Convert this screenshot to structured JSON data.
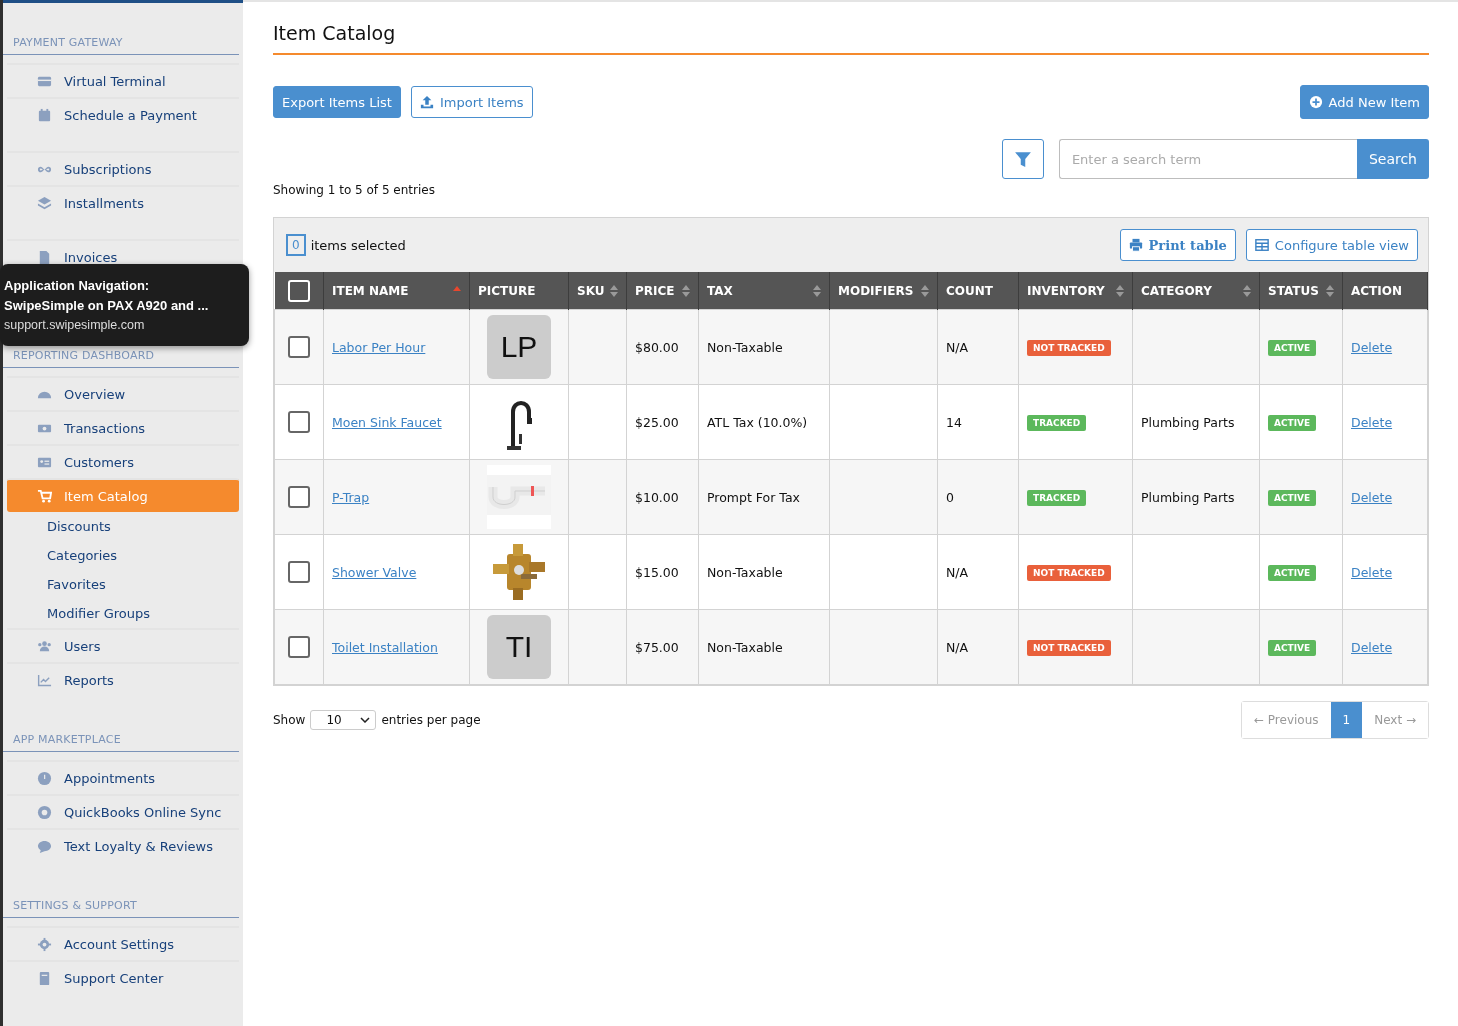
{
  "sidebar": {
    "sections": [
      {
        "title": "PAYMENT GATEWAY",
        "groups": [
          [
            {
              "label": "Virtual Terminal",
              "kind": "main",
              "selected": false
            },
            {
              "label": "Schedule a Payment",
              "kind": "main",
              "selected": false
            }
          ],
          [
            {
              "label": "Subscriptions",
              "kind": "main",
              "selected": false
            },
            {
              "label": "Installments",
              "kind": "main",
              "selected": false
            }
          ],
          [
            {
              "label": "Invoices",
              "kind": "main",
              "selected": false
            }
          ]
        ]
      },
      {
        "title": "REPORTING DASHBOARD",
        "groups": [
          [
            {
              "label": "Overview",
              "kind": "main",
              "selected": false
            },
            {
              "label": "Transactions",
              "kind": "main",
              "selected": false
            },
            {
              "label": "Customers",
              "kind": "main",
              "selected": false
            },
            {
              "label": "Item Catalog",
              "kind": "main",
              "selected": true
            },
            {
              "label": "Discounts",
              "kind": "sub",
              "selected": false
            },
            {
              "label": "Categories",
              "kind": "sub",
              "selected": false
            },
            {
              "label": "Favorites",
              "kind": "sub",
              "selected": false
            },
            {
              "label": "Modifier Groups",
              "kind": "sub",
              "selected": false
            },
            {
              "label": "Users",
              "kind": "main",
              "selected": false
            },
            {
              "label": "Reports",
              "kind": "main",
              "selected": false
            }
          ]
        ]
      },
      {
        "title": "APP MARKETPLACE",
        "groups": [
          [
            {
              "label": "Appointments",
              "kind": "main",
              "selected": false
            },
            {
              "label": "QuickBooks Online Sync",
              "kind": "main",
              "selected": false
            },
            {
              "label": "Text Loyalty & Reviews",
              "kind": "main",
              "selected": false
            }
          ]
        ]
      },
      {
        "title": "SETTINGS & SUPPORT",
        "groups": [
          [
            {
              "label": "Account Settings",
              "kind": "main",
              "selected": false
            },
            {
              "label": "Support Center",
              "kind": "main",
              "selected": false
            }
          ]
        ]
      }
    ]
  },
  "tooltip": {
    "title": "Application Navigation:",
    "subtitle": "SwipeSimple on PAX A920 and ...",
    "url": "support.swipesimple.com"
  },
  "page": {
    "title": "Item Catalog",
    "export_button": "Export Items List",
    "import_button": "Import Items",
    "add_button": "Add New Item",
    "search": {
      "placeholder": "Enter a search term",
      "button": "Search"
    },
    "showing": "Showing 1 to 5 of 5 entries"
  },
  "table": {
    "select_all_checked": false,
    "selected_count": "0",
    "selected_label": "items selected",
    "print_button": "Print table",
    "configure_button": "Configure table view",
    "columns": [
      {
        "label": "ITEM NAME",
        "sortable": true,
        "sorted": true
      },
      {
        "label": "PICTURE",
        "sortable": false,
        "sorted": false
      },
      {
        "label": "SKU",
        "sortable": true,
        "sorted": false
      },
      {
        "label": "PRICE",
        "sortable": true,
        "sorted": false
      },
      {
        "label": "TAX",
        "sortable": true,
        "sorted": false
      },
      {
        "label": "MODIFIERS",
        "sortable": true,
        "sorted": false
      },
      {
        "label": "COUNT",
        "sortable": false,
        "sorted": false
      },
      {
        "label": "INVENTORY",
        "sortable": true,
        "sorted": false
      },
      {
        "label": "CATEGORY",
        "sortable": true,
        "sorted": false
      },
      {
        "label": "STATUS",
        "sortable": true,
        "sorted": false
      },
      {
        "label": "ACTION",
        "sortable": false,
        "sorted": false
      }
    ],
    "rows": [
      {
        "checked": false,
        "name": "Labor Per Hour",
        "picture": {
          "kind": "initials",
          "text": "LP"
        },
        "price": "$80.00",
        "tax": "Non-Taxable",
        "count": "N/A",
        "inventory": {
          "label": "NOT TRACKED",
          "tracked": false
        },
        "status": "ACTIVE",
        "action": "Delete"
      },
      {
        "checked": false,
        "name": "Moen Sink Faucet",
        "price": "$25.00",
        "tax": "ATL Tax (10.0%)",
        "count": "14",
        "inventory": {
          "label": "TRACKED",
          "tracked": true
        },
        "category": "Plumbing Parts",
        "status": "ACTIVE",
        "action": "Delete"
      },
      {
        "checked": false,
        "name": "P-Trap",
        "price": "$10.00",
        "tax": "Prompt For Tax",
        "count": "0",
        "inventory": {
          "label": "TRACKED",
          "tracked": true
        },
        "category": "Plumbing Parts",
        "status": "ACTIVE",
        "action": "Delete"
      },
      {
        "checked": false,
        "name": "Shower Valve",
        "price": "$15.00",
        "tax": "Non-Taxable",
        "count": "N/A",
        "inventory": {
          "label": "NOT TRACKED",
          "tracked": false
        },
        "status": "ACTIVE",
        "action": "Delete"
      },
      {
        "checked": false,
        "name": "Toilet Installation",
        "picture": {
          "kind": "initials",
          "text": "TI"
        },
        "price": "$75.00",
        "tax": "Non-Taxable",
        "count": "N/A",
        "inventory": {
          "label": "NOT TRACKED",
          "tracked": false
        },
        "status": "ACTIVE",
        "action": "Delete"
      }
    ]
  },
  "footer": {
    "show_label": "Show",
    "per_page": "10",
    "per_page_label": "entries per page",
    "pagination": [
      {
        "label": "← Previous",
        "selected": false
      },
      {
        "label": "1",
        "selected": true
      },
      {
        "label": "Next →",
        "selected": false
      }
    ]
  }
}
